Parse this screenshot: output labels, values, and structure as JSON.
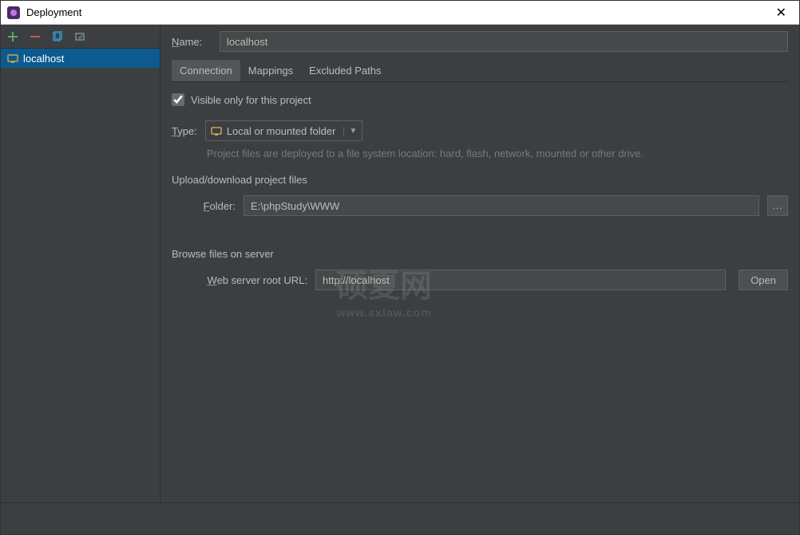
{
  "window": {
    "title": "Deployment"
  },
  "sidebar": {
    "servers": [
      {
        "name": "localhost"
      }
    ]
  },
  "form": {
    "name_label": "Name:",
    "name_value": "localhost",
    "tabs": [
      {
        "label": "Connection",
        "active": true
      },
      {
        "label": "Mappings",
        "active": false
      },
      {
        "label": "Excluded Paths",
        "active": false
      }
    ],
    "visible_only_label": "Visible only for this project",
    "visible_only_checked": true,
    "type_label": "Type:",
    "type_value": "Local or mounted folder",
    "type_hint": "Project files are deployed to a file system location: hard, flash, network, mounted or other drive.",
    "upload_section": "Upload/download project files",
    "folder_label": "Folder:",
    "folder_value": "E:\\phpStudy\\WWW",
    "browse_section": "Browse files on server",
    "web_root_label": "Web server root URL:",
    "web_root_value": "http://localhost",
    "open_button": "Open"
  },
  "watermark": {
    "main": "硕夏网",
    "sub": "www.sxlaw.com"
  }
}
